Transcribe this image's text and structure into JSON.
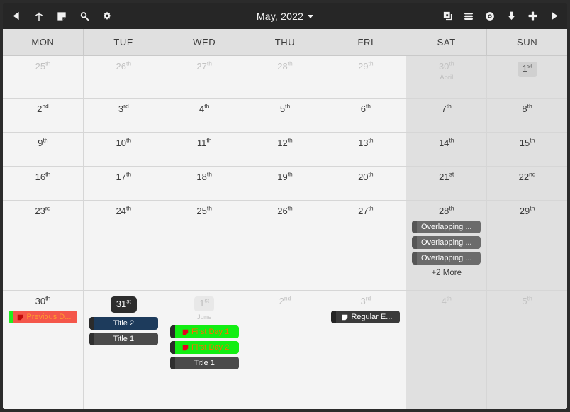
{
  "toolbar": {
    "left_icons": [
      {
        "name": "previous-arrow-icon",
        "glyph": "triangle-left"
      },
      {
        "name": "upload-icon",
        "glyph": "arrow-up-circle"
      },
      {
        "name": "event-note-icon",
        "glyph": "note-square"
      },
      {
        "name": "search-icon",
        "glyph": "magnifier"
      },
      {
        "name": "settings-gear-icon",
        "glyph": "gear"
      }
    ],
    "title": "May, 2022",
    "right_icons": [
      {
        "name": "window-overlap-icon",
        "glyph": "overlap-squares"
      },
      {
        "name": "list-menu-icon",
        "glyph": "hamburger-rounded"
      },
      {
        "name": "visibility-eye-icon",
        "glyph": "eye"
      },
      {
        "name": "download-icon",
        "glyph": "arrow-down"
      },
      {
        "name": "add-plus-icon",
        "glyph": "plus"
      },
      {
        "name": "next-arrow-icon",
        "glyph": "triangle-right"
      }
    ]
  },
  "weekdays": [
    "MON",
    "TUE",
    "WED",
    "THU",
    "FRI",
    "SAT",
    "SUN"
  ],
  "colors": {
    "toolbar_bg": "#262626",
    "window_bg": "#2b2b2b",
    "cell_bg": "#f4f4f4",
    "weekend_bg": "#e0e0e0",
    "header_bg": "#e0e0e0",
    "grid_line": "#d6d6d6",
    "event_gray": "#6b6b6b",
    "event_dark": "#4a4a4a",
    "event_darker": "#333333",
    "event_navy": "#1d3b5c",
    "event_green": "#12ee12",
    "event_red": "#f4564a",
    "accent_today": "#2d2d2d"
  },
  "weeks": [
    {
      "row": 0,
      "days": [
        {
          "num": "25",
          "ord": "th",
          "other": true,
          "weekend": false,
          "badge": "none",
          "month": "",
          "events": [],
          "more": ""
        },
        {
          "num": "26",
          "ord": "th",
          "other": true,
          "weekend": false,
          "badge": "none",
          "month": "",
          "events": [],
          "more": ""
        },
        {
          "num": "27",
          "ord": "th",
          "other": true,
          "weekend": false,
          "badge": "none",
          "month": "",
          "events": [],
          "more": ""
        },
        {
          "num": "28",
          "ord": "th",
          "other": true,
          "weekend": false,
          "badge": "none",
          "month": "",
          "events": [],
          "more": ""
        },
        {
          "num": "29",
          "ord": "th",
          "other": true,
          "weekend": false,
          "badge": "none",
          "month": "",
          "events": [],
          "more": ""
        },
        {
          "num": "30",
          "ord": "th",
          "other": true,
          "weekend": true,
          "badge": "none",
          "month": "April",
          "events": [],
          "more": ""
        },
        {
          "num": "1",
          "ord": "st",
          "other": false,
          "weekend": true,
          "badge": "light",
          "month": "",
          "events": [],
          "more": ""
        }
      ]
    },
    {
      "row": 1,
      "days": [
        {
          "num": "2",
          "ord": "nd",
          "other": false,
          "weekend": false,
          "badge": "none",
          "month": "",
          "events": [],
          "more": ""
        },
        {
          "num": "3",
          "ord": "rd",
          "other": false,
          "weekend": false,
          "badge": "none",
          "month": "",
          "events": [],
          "more": ""
        },
        {
          "num": "4",
          "ord": "th",
          "other": false,
          "weekend": false,
          "badge": "none",
          "month": "",
          "events": [],
          "more": ""
        },
        {
          "num": "5",
          "ord": "th",
          "other": false,
          "weekend": false,
          "badge": "none",
          "month": "",
          "events": [],
          "more": ""
        },
        {
          "num": "6",
          "ord": "th",
          "other": false,
          "weekend": false,
          "badge": "none",
          "month": "",
          "events": [],
          "more": ""
        },
        {
          "num": "7",
          "ord": "th",
          "other": false,
          "weekend": true,
          "badge": "none",
          "month": "",
          "events": [],
          "more": ""
        },
        {
          "num": "8",
          "ord": "th",
          "other": false,
          "weekend": true,
          "badge": "none",
          "month": "",
          "events": [],
          "more": ""
        }
      ]
    },
    {
      "row": 2,
      "days": [
        {
          "num": "9",
          "ord": "th",
          "other": false,
          "weekend": false,
          "badge": "none",
          "month": "",
          "events": [],
          "more": ""
        },
        {
          "num": "10",
          "ord": "th",
          "other": false,
          "weekend": false,
          "badge": "none",
          "month": "",
          "events": [],
          "more": ""
        },
        {
          "num": "11",
          "ord": "th",
          "other": false,
          "weekend": false,
          "badge": "none",
          "month": "",
          "events": [],
          "more": ""
        },
        {
          "num": "12",
          "ord": "th",
          "other": false,
          "weekend": false,
          "badge": "none",
          "month": "",
          "events": [],
          "more": ""
        },
        {
          "num": "13",
          "ord": "th",
          "other": false,
          "weekend": false,
          "badge": "none",
          "month": "",
          "events": [],
          "more": ""
        },
        {
          "num": "14",
          "ord": "th",
          "other": false,
          "weekend": true,
          "badge": "none",
          "month": "",
          "events": [],
          "more": ""
        },
        {
          "num": "15",
          "ord": "th",
          "other": false,
          "weekend": true,
          "badge": "none",
          "month": "",
          "events": [],
          "more": ""
        }
      ]
    },
    {
      "row": 3,
      "days": [
        {
          "num": "16",
          "ord": "th",
          "other": false,
          "weekend": false,
          "badge": "none",
          "month": "",
          "events": [],
          "more": ""
        },
        {
          "num": "17",
          "ord": "th",
          "other": false,
          "weekend": false,
          "badge": "none",
          "month": "",
          "events": [],
          "more": ""
        },
        {
          "num": "18",
          "ord": "th",
          "other": false,
          "weekend": false,
          "badge": "none",
          "month": "",
          "events": [],
          "more": ""
        },
        {
          "num": "19",
          "ord": "th",
          "other": false,
          "weekend": false,
          "badge": "none",
          "month": "",
          "events": [],
          "more": ""
        },
        {
          "num": "20",
          "ord": "th",
          "other": false,
          "weekend": false,
          "badge": "none",
          "month": "",
          "events": [],
          "more": ""
        },
        {
          "num": "21",
          "ord": "st",
          "other": false,
          "weekend": true,
          "badge": "none",
          "month": "",
          "events": [],
          "more": ""
        },
        {
          "num": "22",
          "ord": "nd",
          "other": false,
          "weekend": true,
          "badge": "none",
          "month": "",
          "events": [],
          "more": ""
        }
      ]
    },
    {
      "row": 4,
      "days": [
        {
          "num": "23",
          "ord": "rd",
          "other": false,
          "weekend": false,
          "badge": "none",
          "month": "",
          "events": [],
          "more": ""
        },
        {
          "num": "24",
          "ord": "th",
          "other": false,
          "weekend": false,
          "badge": "none",
          "month": "",
          "events": [],
          "more": ""
        },
        {
          "num": "25",
          "ord": "th",
          "other": false,
          "weekend": false,
          "badge": "none",
          "month": "",
          "events": [],
          "more": ""
        },
        {
          "num": "26",
          "ord": "th",
          "other": false,
          "weekend": false,
          "badge": "none",
          "month": "",
          "events": [],
          "more": ""
        },
        {
          "num": "27",
          "ord": "th",
          "other": false,
          "weekend": false,
          "badge": "none",
          "month": "",
          "events": [],
          "more": ""
        },
        {
          "num": "28",
          "ord": "th",
          "other": false,
          "weekend": true,
          "badge": "none",
          "month": "",
          "events": [
            {
              "label": "Overlapping ...",
              "bg": "#6b6b6b",
              "fg": "#ffffff",
              "stripe": "#565656",
              "icon": false
            },
            {
              "label": "Overlapping ...",
              "bg": "#6b6b6b",
              "fg": "#ffffff",
              "stripe": "#565656",
              "icon": false
            },
            {
              "label": "Overlapping ...",
              "bg": "#6b6b6b",
              "fg": "#ffffff",
              "stripe": "#565656",
              "icon": false
            }
          ],
          "more": "+2 More"
        },
        {
          "num": "29",
          "ord": "th",
          "other": false,
          "weekend": true,
          "badge": "none",
          "month": "",
          "events": [],
          "more": ""
        }
      ]
    },
    {
      "row": 5,
      "days": [
        {
          "num": "30",
          "ord": "th",
          "other": false,
          "weekend": false,
          "badge": "none",
          "month": "",
          "events": [
            {
              "label": "Previous D...",
              "bg": "#f4564a",
              "fg": "#ff9a2e",
              "stripe": "#1eee1e",
              "icon": true,
              "icon_color": "#c40b0b"
            }
          ],
          "more": ""
        },
        {
          "num": "31",
          "ord": "st",
          "other": false,
          "weekend": false,
          "badge": "dark",
          "month": "",
          "events": [
            {
              "label": "Title 2",
              "bg": "#1d3b5c",
              "fg": "#ffffff",
              "stripe": "#2b2b2b",
              "icon": false
            },
            {
              "label": "Title 1",
              "bg": "#4a4a4a",
              "fg": "#ffffff",
              "stripe": "#2f2f2f",
              "icon": false
            }
          ],
          "more": ""
        },
        {
          "num": "1",
          "ord": "st",
          "other": true,
          "weekend": false,
          "badge": "light-muted",
          "month": "June",
          "events": [
            {
              "label": "First Day 1",
              "bg": "#12ee12",
              "fg": "#ff6a00",
              "stripe": "#2b2b2b",
              "icon": true,
              "icon_color": "#e8001e"
            },
            {
              "label": "First Day 2",
              "bg": "#12ee12",
              "fg": "#ff6a00",
              "stripe": "#2b2b2b",
              "icon": true,
              "icon_color": "#e8001e"
            },
            {
              "label": "Title 1",
              "bg": "#4a4a4a",
              "fg": "#ffffff",
              "stripe": "#2f2f2f",
              "icon": false
            }
          ],
          "more": ""
        },
        {
          "num": "2",
          "ord": "nd",
          "other": true,
          "weekend": false,
          "badge": "none",
          "month": "",
          "events": [],
          "more": ""
        },
        {
          "num": "3",
          "ord": "rd",
          "other": true,
          "weekend": false,
          "badge": "none",
          "month": "",
          "events": [
            {
              "label": "Regular E...",
              "bg": "#3a3a3a",
              "fg": "#ffffff",
              "stripe": "#242424",
              "icon": true,
              "icon_color": "#ffffff"
            }
          ],
          "more": ""
        },
        {
          "num": "4",
          "ord": "th",
          "other": true,
          "weekend": true,
          "badge": "none",
          "month": "",
          "events": [],
          "more": ""
        },
        {
          "num": "5",
          "ord": "th",
          "other": true,
          "weekend": true,
          "badge": "none",
          "month": "",
          "events": [],
          "more": ""
        }
      ]
    }
  ]
}
